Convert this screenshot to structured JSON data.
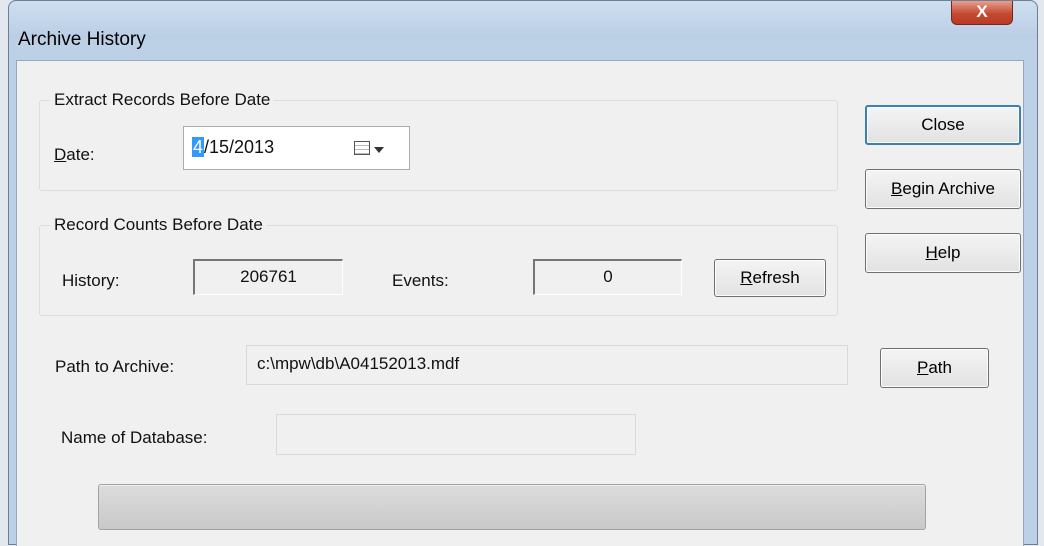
{
  "window": {
    "title": "Archive History",
    "close_glyph": "X"
  },
  "extract_group": {
    "label": "Extract Records Before Date",
    "date_label_u": "D",
    "date_label_rest": "ate:",
    "date_sel": "4",
    "date_rest": "/15/2013",
    "calendar_icon": "calendar-icon"
  },
  "counts_group": {
    "label": "Record Counts Before Date",
    "history_label": "History:",
    "history_value": "206761",
    "events_label": "Events:",
    "events_value": "0",
    "refresh_u": "R",
    "refresh_rest": "efresh"
  },
  "buttons": {
    "close": "Close",
    "begin_u": "B",
    "begin_rest": "egin Archive",
    "help_u": "H",
    "help_rest": "elp",
    "path_u": "P",
    "path_rest": "ath"
  },
  "path": {
    "label": "Path to Archive:",
    "value": "c:\\mpw\\db\\A04152013.mdf"
  },
  "database": {
    "label": "Name of Database:",
    "value": ""
  },
  "progress": {
    "value": 0
  }
}
